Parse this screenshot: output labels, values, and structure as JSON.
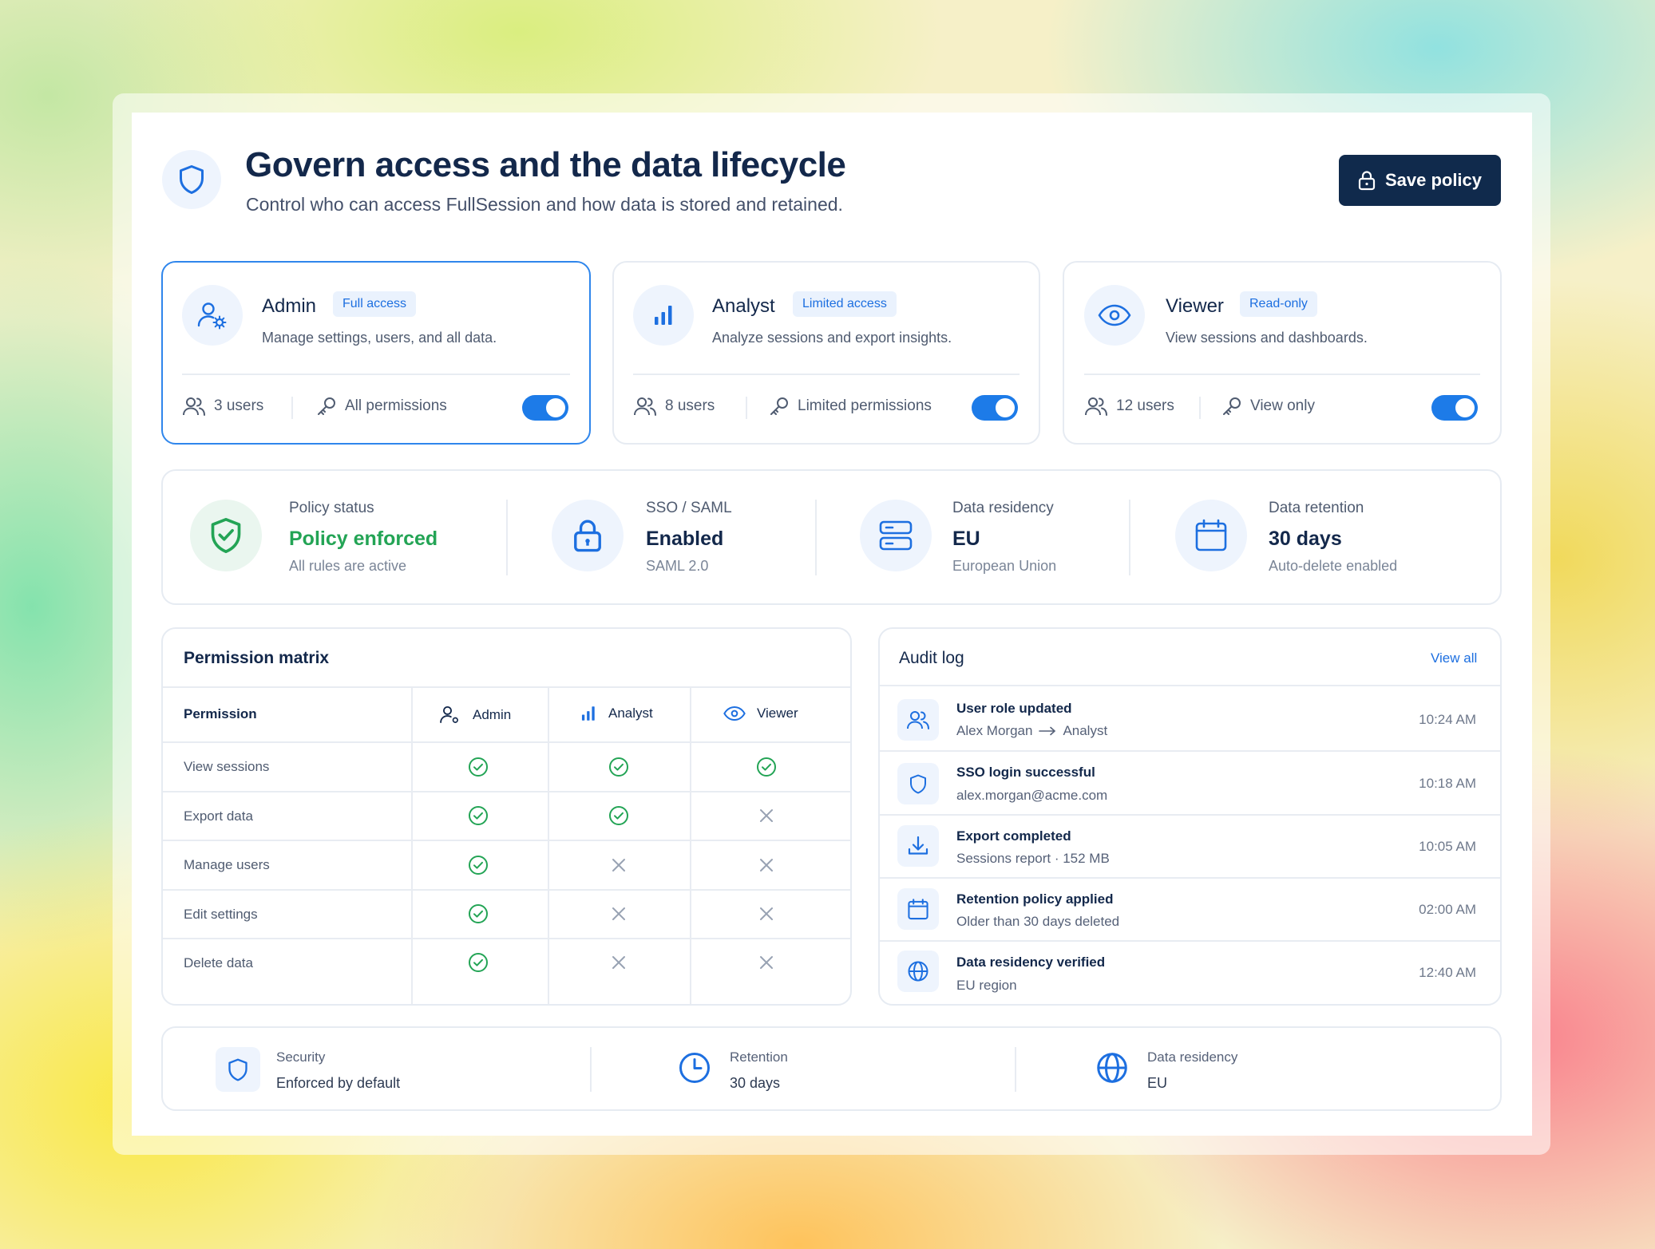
{
  "header": {
    "title": "Govern access and the data lifecycle",
    "subtitle": "Control who can access FullSession and how data is stored and retained.",
    "save_label": "Save policy"
  },
  "roles": [
    {
      "name": "Admin",
      "badge": "Full access",
      "description": "Manage settings, users, and all data.",
      "users": "3 users",
      "permissions": "All permissions",
      "enabled": true,
      "icon": "user-gear-icon"
    },
    {
      "name": "Analyst",
      "badge": "Limited access",
      "description": "Analyze sessions and export insights.",
      "users": "8 users",
      "permissions": "Limited permissions",
      "enabled": true,
      "icon": "bar-chart-icon"
    },
    {
      "name": "Viewer",
      "badge": "Read-only",
      "description": "View sessions and dashboards.",
      "users": "12 users",
      "permissions": "View only",
      "enabled": true,
      "icon": "eye-icon"
    }
  ],
  "status": [
    {
      "label": "Policy status",
      "value": "Policy enforced",
      "sub": "All rules are active",
      "icon": "shield-check-icon",
      "value_color": "#23a455"
    },
    {
      "label": "SSO / SAML",
      "value": "Enabled",
      "sub": "SAML 2.0",
      "icon": "lock-icon"
    },
    {
      "label": "Data residency",
      "value": "EU",
      "sub": "European Union",
      "icon": "server-icon"
    },
    {
      "label": "Data retention",
      "value": "30 days",
      "sub": "Auto-delete enabled",
      "icon": "calendar-icon"
    }
  ],
  "matrix": {
    "title": "Permission matrix",
    "columns": [
      "Permission",
      "Admin",
      "Analyst",
      "Viewer"
    ],
    "rows": [
      {
        "label": "View sessions",
        "values": [
          true,
          true,
          true
        ]
      },
      {
        "label": "Export data",
        "values": [
          true,
          true,
          false
        ]
      },
      {
        "label": "Manage users",
        "values": [
          true,
          false,
          false
        ]
      },
      {
        "label": "Edit settings",
        "values": [
          true,
          false,
          false
        ]
      },
      {
        "label": "Delete data",
        "values": [
          true,
          false,
          false
        ]
      }
    ]
  },
  "audit": {
    "title": "Audit log",
    "view_all": "View all",
    "events": [
      {
        "title": "User role updated",
        "from": "Alex Morgan",
        "to": "Analyst",
        "time": "10:24 AM",
        "icon": "users-icon"
      },
      {
        "title": "SSO login successful",
        "sub": "alex.morgan@acme.com",
        "time": "10:18 AM",
        "icon": "shield-icon"
      },
      {
        "title": "Export completed",
        "sub": "Sessions report · 152 MB",
        "time": "10:05 AM",
        "icon": "download-icon"
      },
      {
        "title": "Retention policy applied",
        "sub": "Older than 30 days deleted",
        "time": "02:00 AM",
        "icon": "calendar-icon"
      },
      {
        "title": "Data residency verified",
        "sub": "EU region",
        "time": "12:40 AM",
        "icon": "globe-icon"
      }
    ]
  },
  "footer": [
    {
      "label": "Security",
      "value": "Enforced by default",
      "icon": "shield-icon"
    },
    {
      "label": "Retention",
      "value": "30 days",
      "icon": "clock-icon"
    },
    {
      "label": "Data residency",
      "value": "EU",
      "icon": "globe-icon"
    }
  ],
  "colors": {
    "accent": "#1d7be8",
    "primary_dark": "#102a4c",
    "success": "#23a455",
    "danger_x": "#98a2b3"
  }
}
